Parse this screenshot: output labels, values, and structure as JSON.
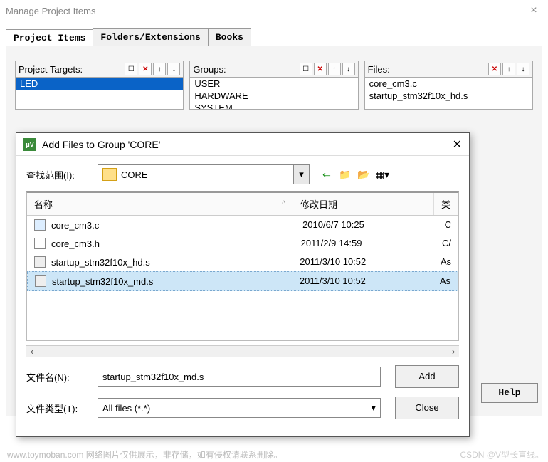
{
  "main": {
    "title": "Manage Project Items",
    "tabs": [
      "Project Items",
      "Folders/Extensions",
      "Books"
    ],
    "active_tab": 0,
    "columns": {
      "targets": {
        "label": "Project Targets:",
        "items": [
          "LED"
        ],
        "selected": 0
      },
      "groups": {
        "label": "Groups:",
        "items": [
          "USER",
          "HARDWARE",
          "SYSTEM"
        ]
      },
      "files": {
        "label": "Files:",
        "items": [
          "core_cm3.c",
          "startup_stm32f10x_hd.s"
        ]
      }
    },
    "help_btn": "Help"
  },
  "dialog": {
    "title": "Add Files to Group 'CORE'",
    "lookin_label": "查找范围(I):",
    "lookin_value": "CORE",
    "headers": {
      "name": "名称",
      "date": "修改日期",
      "type": "类"
    },
    "files": [
      {
        "name": "core_cm3.c",
        "date": "2010/6/7 10:25",
        "type": "C",
        "icon": "c"
      },
      {
        "name": "core_cm3.h",
        "date": "2011/2/9 14:59",
        "type": "C/",
        "icon": "h"
      },
      {
        "name": "startup_stm32f10x_hd.s",
        "date": "2011/3/10 10:52",
        "type": "As",
        "icon": "asm"
      },
      {
        "name": "startup_stm32f10x_md.s",
        "date": "2011/3/10 10:52",
        "type": "As",
        "icon": "asm"
      }
    ],
    "selected_file_index": 3,
    "filename_label": "文件名(N):",
    "filename_value": "startup_stm32f10x_md.s",
    "filetype_label": "文件类型(T):",
    "filetype_value": "All files (*.*)",
    "add_btn": "Add",
    "close_btn": "Close"
  },
  "watermarks": {
    "left": "www.toymoban.com 网络图片仅供展示，非存储，如有侵权请联系删除。",
    "right": "CSDN @V型长直线。"
  }
}
